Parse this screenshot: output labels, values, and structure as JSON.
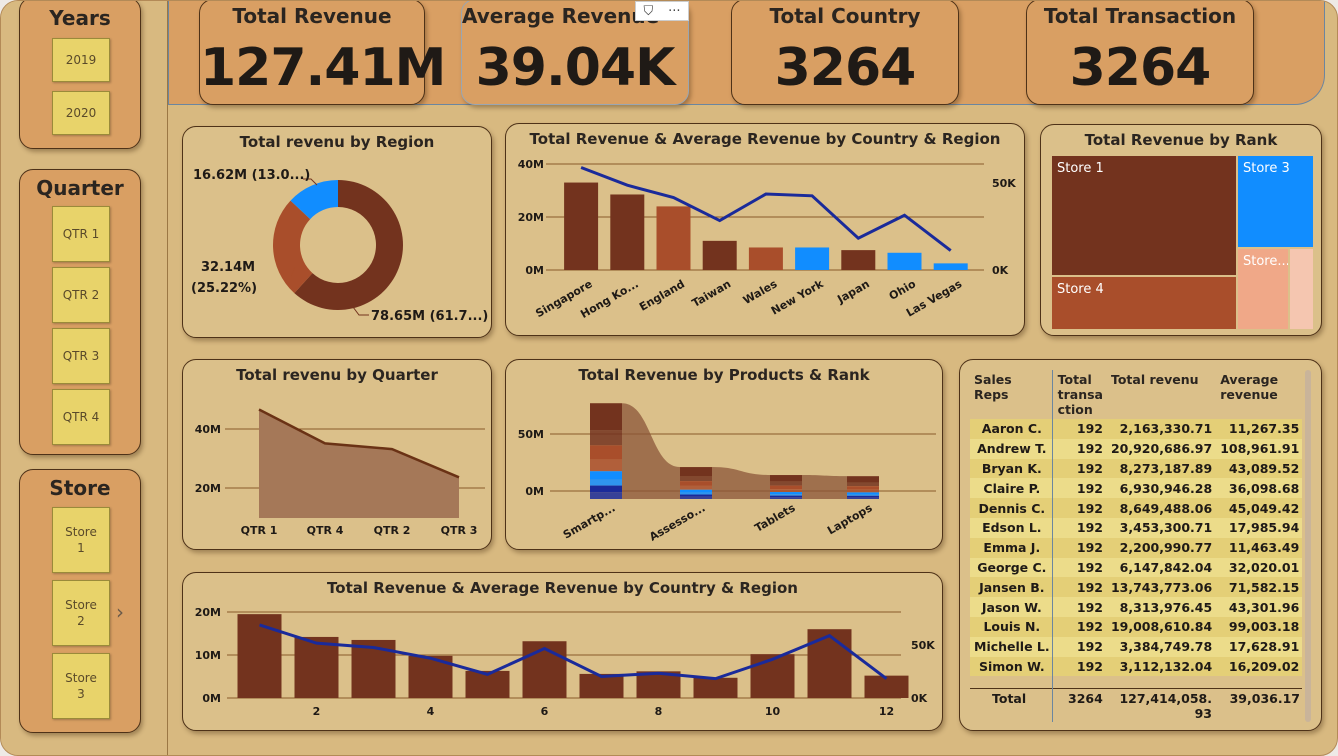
{
  "filters": {
    "years": {
      "title": "Years",
      "options": [
        "2019",
        "2020"
      ]
    },
    "quarter": {
      "title": "Quarter",
      "options": [
        "QTR 1",
        "QTR 2",
        "QTR 3",
        "QTR 4"
      ]
    },
    "store": {
      "title": "Store",
      "options": [
        "Store 1",
        "Store 2",
        "Store 3"
      ]
    }
  },
  "kpis": [
    {
      "label": "Total Revenue",
      "value": "127.41M"
    },
    {
      "label": "Average Revenue",
      "value": "39.04K"
    },
    {
      "label": "Total Country",
      "value": "3264"
    },
    {
      "label": "Total Transaction",
      "value": "3264"
    }
  ],
  "toolbar": {
    "filter_icon": "filter-icon",
    "more_icon": "more-options-icon",
    "more_label": "···",
    "filter_label": "⛉"
  },
  "colors": {
    "dark_brown": "#73331e",
    "rust": "#a94e2b",
    "blue": "#118dff",
    "navy": "#1a2a9a",
    "peach": "#f0a888",
    "light_peach": "#f5c6b0"
  },
  "charts": {
    "region_donut": {
      "title": "Total revenu by Region",
      "labels": {
        "blue": "16.62M (13.0...)",
        "rust_line1": "32.14M",
        "rust_line2": "(25.22%)",
        "dark": "78.65M (61.7...)"
      },
      "chart_data": {
        "type": "pie",
        "values": [
          78.65,
          32.14,
          16.62
        ],
        "percent": [
          61.7,
          25.22,
          13.0
        ]
      }
    },
    "country_combo": {
      "title": "Total Revenue & Average Revenue by Country & Region",
      "y_ticks": [
        "40M",
        "20M",
        "0M"
      ],
      "y2_ticks": [
        "50K",
        "0K"
      ],
      "chart_data": {
        "type": "bar",
        "categories": [
          "Singapore",
          "Hong Ko...",
          "England",
          "Taiwan",
          "Wales",
          "New York",
          "Japan",
          "Ohio",
          "Las Vegas"
        ],
        "revenue_millions": [
          33,
          28.5,
          24,
          11,
          8.5,
          8.5,
          7.5,
          6.5,
          2.5
        ],
        "avg_revenue_k": [
          58,
          48,
          41,
          28,
          43,
          42,
          18,
          31,
          11
        ],
        "ylim": [
          0,
          40
        ],
        "y2lim": [
          0,
          60
        ]
      }
    },
    "rank_treemap": {
      "title": "Total Revenue by Rank",
      "tiles": [
        "Store 1",
        "Store 3",
        "Store 4",
        "Store..."
      ]
    },
    "quarter_area": {
      "title": "Total revenu by Quarter",
      "y_ticks": [
        "40M",
        "20M"
      ],
      "chart_data": {
        "type": "area",
        "categories": [
          "QTR 1",
          "QTR 4",
          "QTR 2",
          "QTR 3"
        ],
        "values": [
          48,
          33,
          30.5,
          18
        ],
        "ylim": [
          0,
          50
        ]
      }
    },
    "products_ribbon": {
      "title": "Total Revenue by Products & Rank",
      "y_ticks": [
        "50M",
        "0M"
      ],
      "chart_data": {
        "type": "bar",
        "categories": [
          "Smartp...",
          "Assesso...",
          "Tablets",
          "Laptops"
        ],
        "values": [
          77,
          21,
          14,
          13
        ],
        "ylim": [
          0,
          90
        ]
      }
    },
    "month_combo": {
      "title": "Total Revenue & Average Revenue by Country & Region",
      "y_ticks": [
        "20M",
        "10M",
        "0M"
      ],
      "y2_ticks": [
        "50K",
        "0K"
      ],
      "x_ticks": [
        "2",
        "4",
        "6",
        "8",
        "10",
        "12"
      ],
      "chart_data": {
        "type": "bar",
        "x": [
          1,
          2,
          3,
          4,
          5,
          6,
          7,
          8,
          9,
          10,
          11,
          12
        ],
        "revenue_millions": [
          19.5,
          14.2,
          13.5,
          9.8,
          6.3,
          13.2,
          5.6,
          6.2,
          4.7,
          10.2,
          16.0,
          5.2
        ],
        "avg_revenue_k": [
          68,
          51,
          47,
          37,
          22,
          46,
          20,
          23,
          18,
          36,
          58,
          18
        ],
        "ylim": [
          0,
          20
        ],
        "y2lim": [
          0,
          80
        ]
      }
    }
  },
  "sales_table": {
    "headers": [
      "Sales Reps",
      "Total transa ction",
      "Total revenu",
      "Average revenue"
    ],
    "rows": [
      [
        "Aaron C.",
        "192",
        "2,163,330.71",
        "11,267.35"
      ],
      [
        "Andrew T.",
        "192",
        "20,920,686.97",
        "108,961.91"
      ],
      [
        "Bryan K.",
        "192",
        "8,273,187.89",
        "43,089.52"
      ],
      [
        "Claire P.",
        "192",
        "6,930,946.28",
        "36,098.68"
      ],
      [
        "Dennis C.",
        "192",
        "8,649,488.06",
        "45,049.42"
      ],
      [
        "Edson L.",
        "192",
        "3,453,300.71",
        "17,985.94"
      ],
      [
        "Emma J.",
        "192",
        "2,200,990.77",
        "11,463.49"
      ],
      [
        "George C.",
        "192",
        "6,147,842.04",
        "32,020.01"
      ],
      [
        "Jansen B.",
        "192",
        "13,743,773.06",
        "71,582.15"
      ],
      [
        "Jason W.",
        "192",
        "8,313,976.45",
        "43,301.96"
      ],
      [
        "Louis N.",
        "192",
        "19,008,610.84",
        "99,003.18"
      ],
      [
        "Michelle L.",
        "192",
        "3,384,749.78",
        "17,628.91"
      ],
      [
        "Simon W.",
        "192",
        "3,112,132.04",
        "16,209.02"
      ]
    ],
    "total": [
      "Total",
      "3264",
      "127,414,058.93",
      "39,036.17"
    ]
  }
}
